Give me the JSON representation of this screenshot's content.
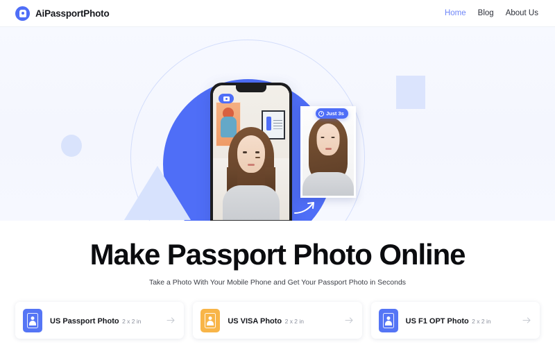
{
  "brand": {
    "name": "AiPassportPhoto",
    "logo_icon": "camera-circle-icon",
    "color": "#4f6ef7"
  },
  "nav": {
    "links": [
      {
        "label": "Home",
        "active": true
      },
      {
        "label": "Blog",
        "active": false
      },
      {
        "label": "About Us",
        "active": false
      }
    ],
    "active_color": "#6f86f8",
    "inactive_color": "#2c2f38"
  },
  "hero": {
    "background_color": "#f5f7fe",
    "accent_circle_color": "#4f6ef7",
    "shape_color_light": "#d9e3fc",
    "phone": {
      "camera_badge_icon": "camera-icon",
      "shutter_icon": "shutter-button",
      "gallery_icon": "gallery-thumbnail-icon",
      "flip_icon": "flip-camera-icon"
    },
    "speed_badge": {
      "label": "Just 3s",
      "icon": "clock-icon",
      "background": "#4f6ef7"
    },
    "arrow_icon": "curved-arrow-icon",
    "result_photo_alt": "generated-passport-photo"
  },
  "headline": {
    "title": "Make Passport Photo Online",
    "subtitle": "Take a Photo With Your Mobile Phone and Get Your Passport Photo in Seconds"
  },
  "cards": [
    {
      "title": "US Passport Photo",
      "size": "2 x 2 in",
      "icon": "passport-photo-icon",
      "icon_color": "#5575f5",
      "arrow_icon": "arrow-right-icon"
    },
    {
      "title": "US VISA Photo",
      "size": "2 x 2 in",
      "icon": "visa-photo-icon",
      "icon_color": "#f8b548",
      "arrow_icon": "arrow-right-icon"
    },
    {
      "title": "US F1 OPT Photo",
      "size": "2 x 2 in",
      "icon": "f1-opt-photo-icon",
      "icon_color": "#5575f5",
      "arrow_icon": "arrow-right-icon"
    }
  ]
}
